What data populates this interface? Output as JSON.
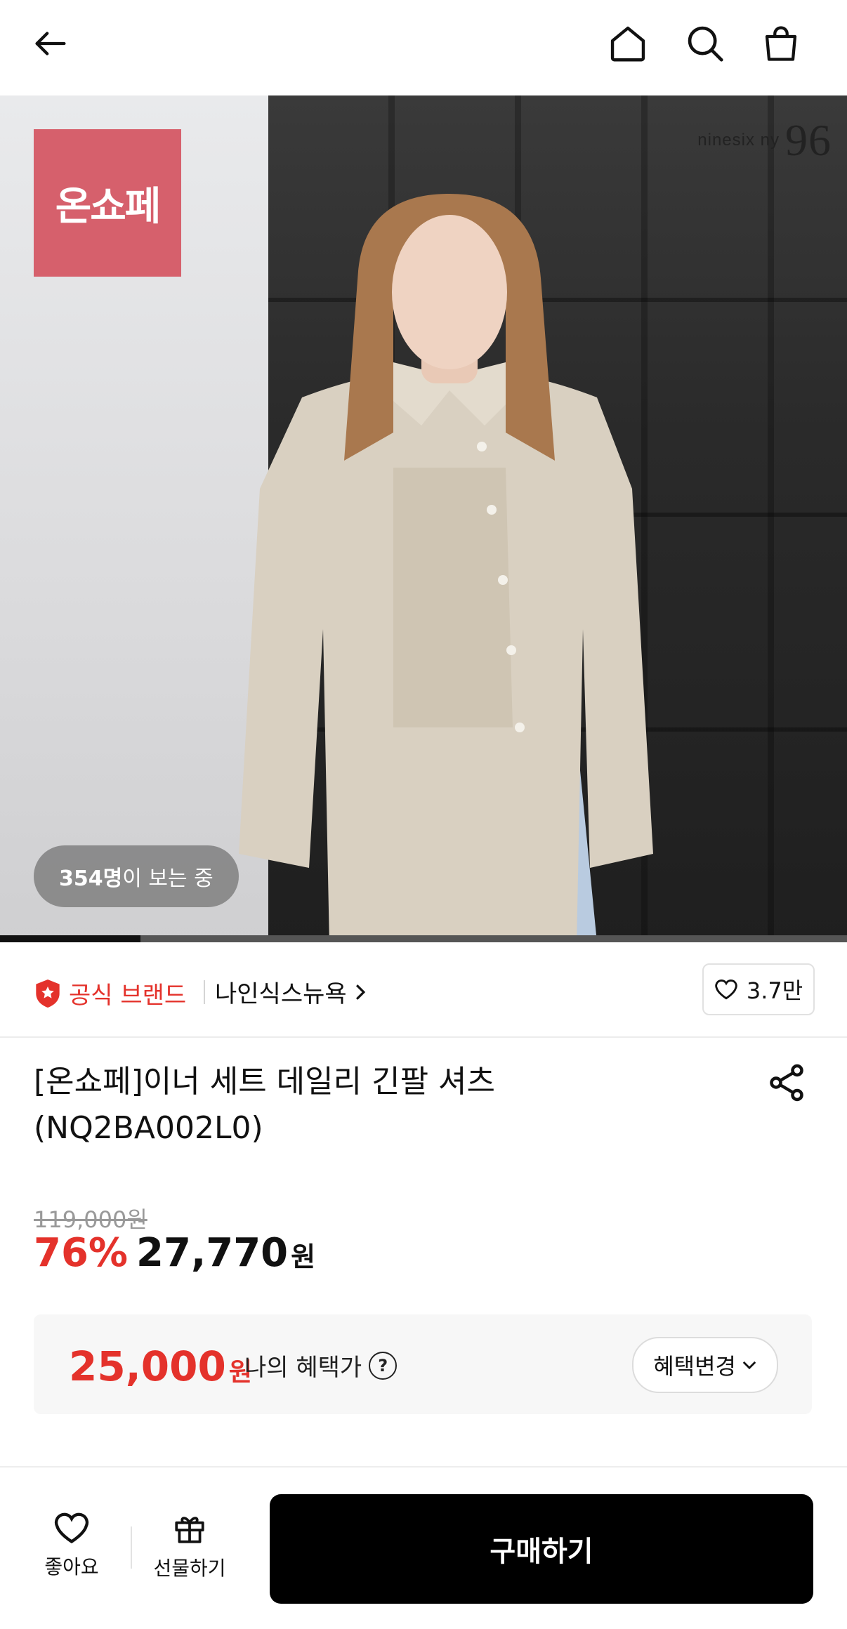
{
  "header": {
    "back_icon": "arrow-left-icon",
    "home_icon": "home-icon",
    "search_icon": "search-icon",
    "cart_icon": "shopping-bag-icon"
  },
  "hero": {
    "badge_text": "온쇼페",
    "badge_color": "#d6606c",
    "watermark_text": "ninesix ny",
    "watermark_mark": "96",
    "viewers_count": "354명",
    "viewers_suffix": "이 보는 중",
    "carousel_progress": 0.166
  },
  "brand_row": {
    "official_label": "공식 브랜드",
    "brand_name": "나인식스뉴욕",
    "like_count": "3.7만"
  },
  "product": {
    "title_line1": "[온쇼페]이너 세트 데일리 긴팔 셔츠",
    "title_line2": "(NQ2BA002L0)",
    "original_price": "119,000원",
    "discount_rate": "76%",
    "sale_price": "27,770",
    "currency": "원"
  },
  "benefit": {
    "price": "25,000",
    "currency": "원",
    "label": "나의 혜택가",
    "help": "?",
    "change_button": "혜택변경"
  },
  "bottom_bar": {
    "like_label": "좋아요",
    "gift_label": "선물하기",
    "buy_label": "구매하기"
  },
  "colors": {
    "accent_red": "#e4322b",
    "buy_button": "#000000"
  }
}
